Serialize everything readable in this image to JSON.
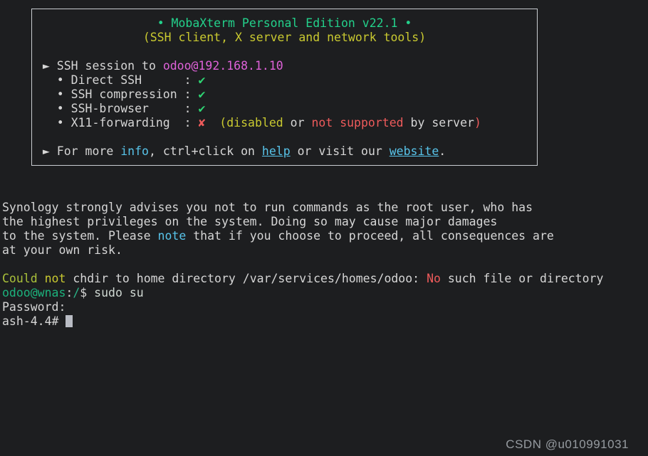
{
  "colors": {
    "background": "#1d1e20",
    "box_border": "#c9cdd1",
    "text": "#d6d6d6",
    "green": "#23d18b",
    "yellow": "#c9c930",
    "magenta": "#df62d9",
    "check_green": "#2ed573",
    "red": "#ee5b5b",
    "cyan": "#58c4ea",
    "olive_green": "#a9c03a",
    "prompt_green": "#1cb27c",
    "teal": "#2bb387",
    "cmd": "#cfd8d2",
    "cursor": "#b9bcc4",
    "watermark": "#969ba0"
  },
  "banner": {
    "title": "• MobaXterm Personal Edition v22.1 •",
    "subtitle": "(SSH client, X server and network tools)",
    "session_prefix": " ► SSH session to ",
    "session_host": "odoo@192.168.1.10",
    "feature_direct_label": "   • Direct SSH      : ",
    "feature_direct_mark": "✔",
    "feature_compression_label": "   • SSH compression : ",
    "feature_compression_mark": "✔",
    "feature_browser_label": "   • SSH-browser     : ",
    "feature_browser_mark": "✔",
    "feature_x11_label": "   • X11-forwarding  : ",
    "feature_x11_mark": "✘",
    "feature_x11_gap": "  ",
    "feature_x11_disabled": "(disabled",
    "feature_x11_or": " or ",
    "feature_x11_notsupported": "not supported",
    "feature_x11_byserver": " by server",
    "feature_x11_close": ")",
    "footer_prefix": " ► For more ",
    "footer_info": "info",
    "footer_mid1": ", ctrl+click on ",
    "footer_help": "help",
    "footer_mid2": " or visit our ",
    "footer_website": "website",
    "footer_end": "."
  },
  "output": {
    "warning_line1": "Synology strongly advises you not to run commands as the root user, who has",
    "warning_line2": "the highest privileges on the system. Doing so may cause major damages",
    "warning_line3_pre": "to the system. Please ",
    "warning_line3_note": "note",
    "warning_line3_post": " that if you choose to proceed, all consequences are",
    "warning_line4": "at your own risk.",
    "chdir_could": "Could ",
    "chdir_not": "not",
    "chdir_mid": " chdir to home directory /var/services/homes/odoo: ",
    "chdir_no": "No",
    "chdir_end": " such file or directory",
    "prompt_user_host": "odoo@wnas",
    "prompt_colon": ":",
    "prompt_path": "/",
    "prompt_dollar": "$ ",
    "prompt_command": "sudo su",
    "password_label": "Password:",
    "root_prompt": "ash-4.4# "
  },
  "watermark": "CSDN @u010991031"
}
